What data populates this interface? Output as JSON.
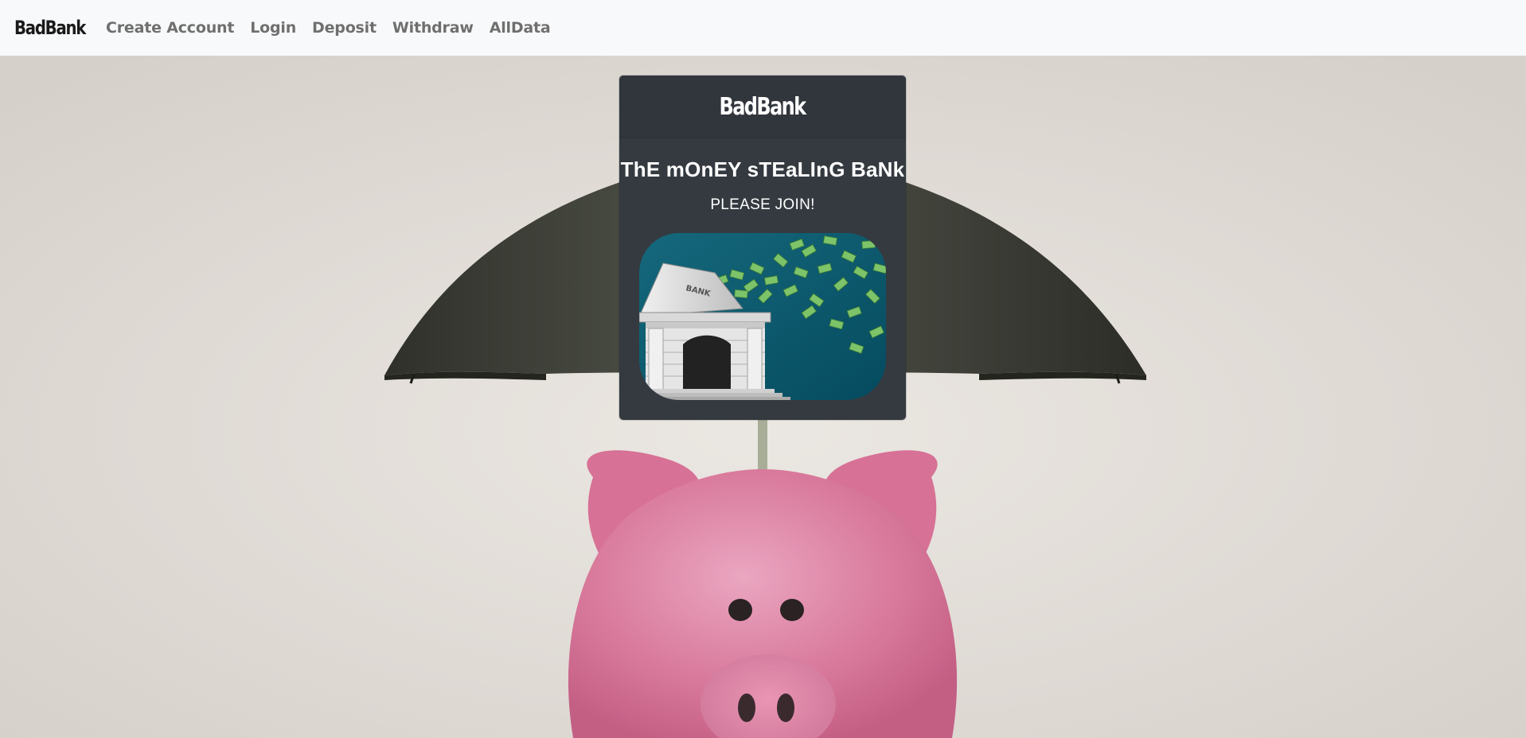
{
  "navbar": {
    "brand": "BadBank",
    "links": [
      {
        "label": "Create Account"
      },
      {
        "label": "Login"
      },
      {
        "label": "Deposit"
      },
      {
        "label": "Withdraw"
      },
      {
        "label": "AllData"
      }
    ]
  },
  "card": {
    "header": "BadBank",
    "title": "ThE mOnEY sTEaLInG BaNk",
    "text": "PLEASE JOIN!",
    "image": {
      "icon": "bank-money-icon",
      "sign": "BANK"
    }
  },
  "background": {
    "icon": "piggy-bank-umbrella-icon"
  },
  "colors": {
    "navbar_bg": "#f8f9fa",
    "nav_link": "#6f6f6f",
    "card_bg": "#343a40",
    "page_bg": "#e2ddd7",
    "image_bg": "#0e5a6d"
  }
}
